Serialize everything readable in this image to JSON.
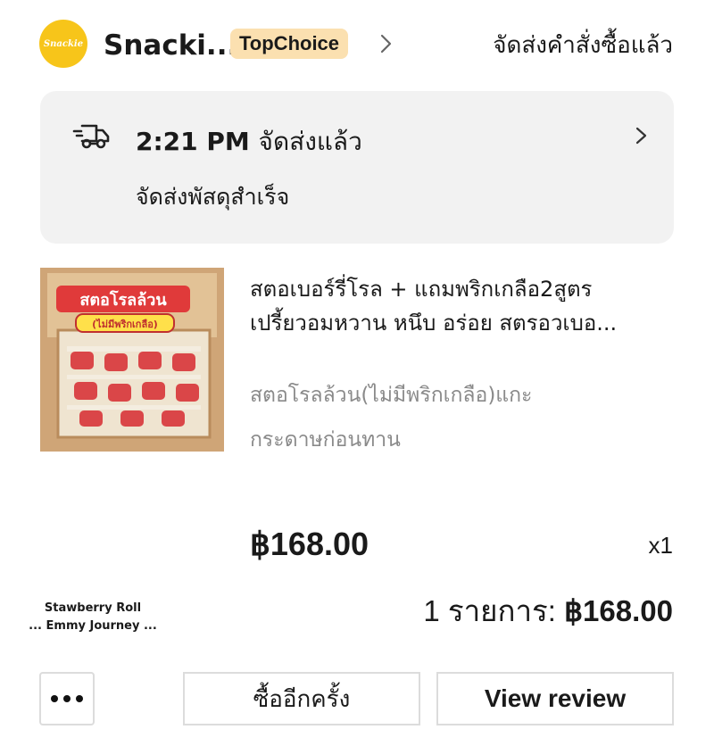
{
  "shop": {
    "logo_text": "Snackie",
    "name": "Snacki...",
    "badge": "TopChoice",
    "order_status": "จัดส่งคำสั่งซื้อแล้ว"
  },
  "delivery": {
    "time": "2:21 PM",
    "status": "จัดส่งแล้ว",
    "subtext": "จัดส่งพัสดุสำเร็จ"
  },
  "product": {
    "image_label_1": "สตอโรลล้วน",
    "image_label_2": "(ไม่มีพริกเกลือ)",
    "title_line_1": "สตอเบอร์รี่โรล + แถมพริกเกลือ2สูตร",
    "title_line_2": "เปรี้ยวอมหวาน หนึบ อร่อย สตรอวเบอ...",
    "variant_line_1": "สตอโรลล้วน(ไม่มีพริกเกลือ)แกะ",
    "variant_line_2": "กระดาษก่อนทาน",
    "price": "฿168.00",
    "quantity": "x1"
  },
  "stamp": {
    "line_1": "Stawberry Roll",
    "line_2": "... Emmy Journey ..."
  },
  "summary": {
    "items_label": "1 รายการ:",
    "total": "฿168.00"
  },
  "actions": {
    "buy_again": "ซื้ออีกครั้ง",
    "view_review": "View review"
  },
  "colors": {
    "logo_bg": "#f7c51a",
    "badge_bg": "#fbe0b0",
    "card_bg": "#f2f2f2",
    "product_red": "#e03a3a"
  },
  "icons": {
    "header_chevron": "chevron-right-icon",
    "delivery": "truck-icon",
    "card_chevron": "chevron-right-icon",
    "more": "more-dots-icon"
  }
}
